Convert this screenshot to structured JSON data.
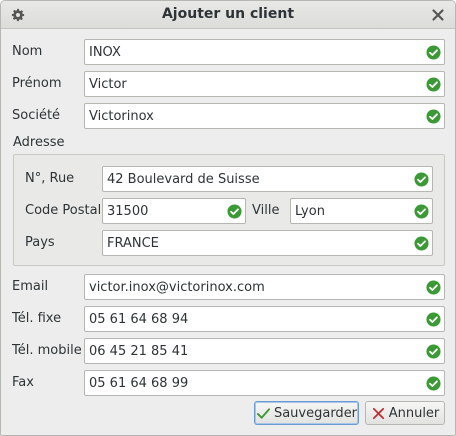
{
  "window": {
    "title": "Ajouter un client"
  },
  "fields": {
    "nom": {
      "label": "Nom",
      "value": "INOX"
    },
    "prenom": {
      "label": "Prénom",
      "value": "Victor"
    },
    "societe": {
      "label": "Société",
      "value": "Victorinox"
    },
    "adresse": {
      "label": "Adresse",
      "rue": {
        "label": "N°, Rue",
        "value": "42 Boulevard de Suisse"
      },
      "code_postal": {
        "label": "Code Postal",
        "value": "31500"
      },
      "ville": {
        "label": "Ville",
        "value": "Lyon"
      },
      "pays": {
        "label": "Pays",
        "value": "FRANCE"
      }
    },
    "email": {
      "label": "Email",
      "value": "victor.inox@victorinox.com"
    },
    "tel_fixe": {
      "label": "Tél. fixe",
      "value": "05 61 64 68 94"
    },
    "tel_mobile": {
      "label": "Tél. mobile",
      "value": "06 45 21 85 41"
    },
    "fax": {
      "label": "Fax",
      "value": "05 61 64 68 99"
    }
  },
  "buttons": {
    "save": "Sauvegarder",
    "cancel": "Annuler"
  },
  "colors": {
    "valid": "#3b9a35",
    "cancel_x": "#c4262d",
    "save_check": "#3b9a35"
  },
  "icons": {
    "valid": "check-circle-icon",
    "menu": "gear-icon",
    "close": "close-icon"
  }
}
